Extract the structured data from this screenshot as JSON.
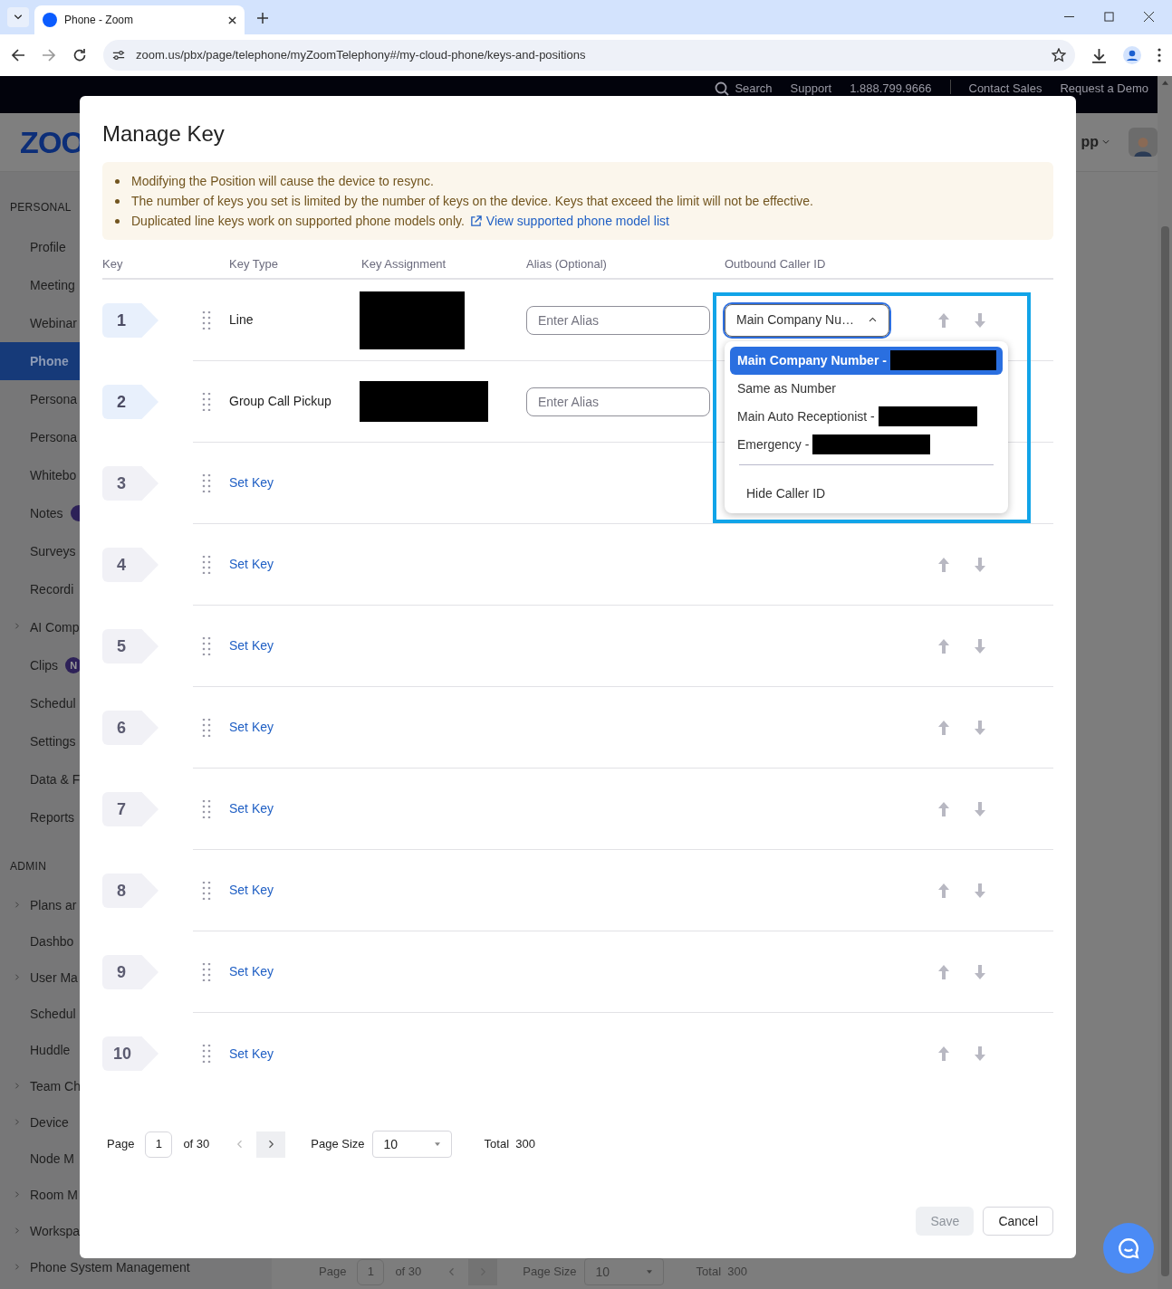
{
  "browser": {
    "tab_title": "Phone - Zoom",
    "url": "zoom.us/pbx/page/telephone/myZoomTelephony#/my-cloud-phone/keys-and-positions"
  },
  "top_nav": [
    "Search",
    "Support",
    "1.888.799.9666",
    "Contact Sales",
    "Request a Demo"
  ],
  "logo": "ZOO",
  "app_menu": "pp",
  "sidebar": [
    {
      "title": "PERSONAL",
      "items": [
        {
          "label": "Profile",
          "selected": false,
          "expandable": false
        },
        {
          "label": "Meeting",
          "selected": false,
          "expandable": false
        },
        {
          "label": "Webinar",
          "selected": false,
          "expandable": false
        },
        {
          "label": "Phone",
          "selected": true,
          "expandable": false
        },
        {
          "label": "Persona",
          "selected": false,
          "expandable": false
        },
        {
          "label": "Persona",
          "selected": false,
          "expandable": false
        },
        {
          "label": "Whitebo",
          "selected": false,
          "expandable": false
        },
        {
          "label": "Notes",
          "selected": false,
          "expandable": false,
          "has_badge": true
        },
        {
          "label": "Surveys",
          "selected": false,
          "expandable": false
        },
        {
          "label": "Recordi",
          "selected": false,
          "expandable": false
        },
        {
          "label": "AI Comp",
          "selected": false,
          "expandable": true
        },
        {
          "label": "Clips",
          "selected": false,
          "expandable": false,
          "has_badge": true,
          "badge": "N"
        },
        {
          "label": "Schedul",
          "selected": false,
          "expandable": false
        },
        {
          "label": "Settings",
          "selected": false,
          "expandable": false
        },
        {
          "label": "Data & F",
          "selected": false,
          "expandable": false
        },
        {
          "label": "Reports",
          "selected": false,
          "expandable": false
        }
      ]
    },
    {
      "title": "ADMIN",
      "items": [
        {
          "label": "Plans ar",
          "selected": false,
          "expandable": true
        },
        {
          "label": "Dashbo",
          "selected": false,
          "expandable": false
        },
        {
          "label": "User Ma",
          "selected": false,
          "expandable": true
        },
        {
          "label": "Schedul",
          "selected": false,
          "expandable": false
        },
        {
          "label": "Huddle",
          "selected": false,
          "expandable": false
        },
        {
          "label": "Team Ch",
          "selected": false,
          "expandable": true
        },
        {
          "label": "Device",
          "selected": false,
          "expandable": true
        },
        {
          "label": "Node M",
          "selected": false,
          "expandable": false
        },
        {
          "label": "Room M",
          "selected": false,
          "expandable": true
        },
        {
          "label": "Workspa",
          "selected": false,
          "expandable": true
        },
        {
          "label": "Phone System Management",
          "selected": false,
          "expandable": true
        }
      ]
    }
  ],
  "background_pagination": {
    "page_label": "Page",
    "page": "1",
    "of": "of 30",
    "page_size_label": "Page Size",
    "page_size": "10",
    "total": "Total  300"
  },
  "modal": {
    "title": "Manage Key",
    "notices": [
      {
        "text": "Modifying the Position will cause the device to resync."
      },
      {
        "text": "The number of keys you set is limited by the number of keys on the device. Keys that exceed the limit will not be effective."
      },
      {
        "text": "Duplicated line keys work on supported phone models only.",
        "link": "View supported phone model list"
      }
    ],
    "columns": [
      "Key",
      "Key Type",
      "Key Assignment",
      "Alias (Optional)",
      "Outbound Caller ID"
    ],
    "keys": [
      {
        "number": "1",
        "kind": "assigned",
        "type": "Line",
        "assignment_redacted": true,
        "alias_placeholder": "Enter Alias",
        "arrows": true,
        "caller_id": {
          "value": "Main Company Nu…",
          "open": true,
          "options": [
            {
              "label": "Main Company Number - ",
              "selected": true,
              "redacted": true,
              "divider_before": false
            },
            {
              "label": "Same as Number",
              "selected": false,
              "redacted": false,
              "divider_before": false
            },
            {
              "label": "Main Auto Receptionist - ",
              "selected": false,
              "redacted": true,
              "divider_before": false
            },
            {
              "label": "Emergency - ",
              "selected": false,
              "redacted": true,
              "divider_before": false
            },
            {
              "label": "Hide Caller ID",
              "selected": false,
              "redacted": false,
              "divider_before": true
            }
          ]
        }
      },
      {
        "number": "2",
        "kind": "assigned",
        "type": "Group Call Pickup",
        "assignment_redacted": true,
        "alias_placeholder": "Enter Alias",
        "arrows": false
      },
      {
        "number": "3",
        "kind": "empty",
        "action": "Set Key",
        "arrows": false
      },
      {
        "number": "4",
        "kind": "empty",
        "action": "Set Key",
        "arrows": true
      },
      {
        "number": "5",
        "kind": "empty",
        "action": "Set Key",
        "arrows": true
      },
      {
        "number": "6",
        "kind": "empty",
        "action": "Set Key",
        "arrows": true
      },
      {
        "number": "7",
        "kind": "empty",
        "action": "Set Key",
        "arrows": true
      },
      {
        "number": "8",
        "kind": "empty",
        "action": "Set Key",
        "arrows": true
      },
      {
        "number": "9",
        "kind": "empty",
        "action": "Set Key",
        "arrows": true
      },
      {
        "number": "10",
        "kind": "empty",
        "action": "Set Key",
        "arrows": true
      }
    ],
    "pagination": {
      "page_label": "Page",
      "page": "1",
      "of": "of 30",
      "page_size_label": "Page Size",
      "page_size": "10",
      "total": "Total  300",
      "prev_disabled": true
    },
    "buttons": [
      {
        "label": "Save",
        "disabled": true
      },
      {
        "label": "Cancel",
        "disabled": false
      }
    ],
    "highlight_frame": true
  }
}
